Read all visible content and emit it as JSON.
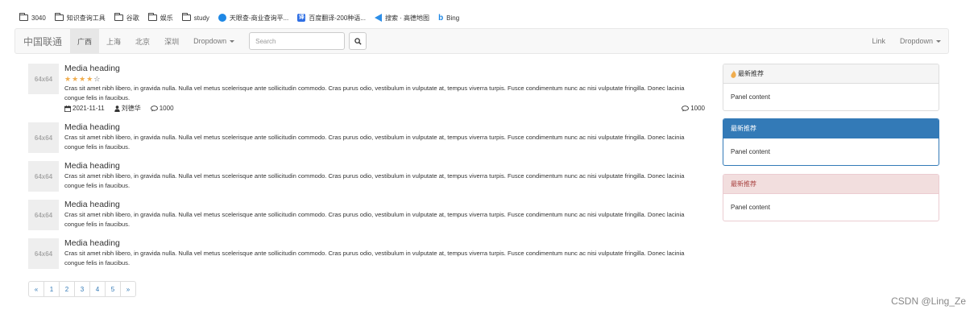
{
  "bookmarks": [
    {
      "label": "3040",
      "icon": "folder-icon"
    },
    {
      "label": "知识查询工具",
      "icon": "folder-icon"
    },
    {
      "label": "谷歌",
      "icon": "folder-icon"
    },
    {
      "label": "娱乐",
      "icon": "folder-icon"
    },
    {
      "label": "study",
      "icon": "folder-icon"
    },
    {
      "label": "天眼查-商业查询平...",
      "icon": "tianyancha-icon"
    },
    {
      "label": "百度翻译-200种语...",
      "icon": "baidu-translate-icon"
    },
    {
      "label": "搜索 · 高德地图",
      "icon": "amap-icon"
    },
    {
      "label": "Bing",
      "icon": "bing-icon"
    }
  ],
  "navbar": {
    "brand": "中国联通",
    "items": [
      "广西",
      "上海",
      "北京",
      "深圳"
    ],
    "active_index": 0,
    "dropdown": "Dropdown",
    "search_placeholder": "Search",
    "right_link": "Link",
    "right_dropdown": "Dropdown"
  },
  "media": {
    "thumb_label": "64x64",
    "items": [
      {
        "heading": "Media heading",
        "rating": 4,
        "rating_max": 5,
        "text": "Cras sit amet nibh libero, in gravida nulla. Nulla vel metus scelerisque ante sollicitudin commodo. Cras purus odio, vestibulum in vulputate at, tempus viverra turpis. Fusce condimentum nunc ac nisi vulputate fringilla. Donec lacinia congue felis in faucibus.",
        "date": "2021-11-11",
        "author": "刘德华",
        "comments": "1000",
        "comments_right": "1000"
      },
      {
        "heading": "Media heading",
        "text": "Cras sit amet nibh libero, in gravida nulla. Nulla vel metus scelerisque ante sollicitudin commodo. Cras purus odio, vestibulum in vulputate at, tempus viverra turpis. Fusce condimentum nunc ac nisi vulputate fringilla. Donec lacinia congue felis in faucibus."
      },
      {
        "heading": "Media heading",
        "text": "Cras sit amet nibh libero, in gravida nulla. Nulla vel metus scelerisque ante sollicitudin commodo. Cras purus odio, vestibulum in vulputate at, tempus viverra turpis. Fusce condimentum nunc ac nisi vulputate fringilla. Donec lacinia congue felis in faucibus."
      },
      {
        "heading": "Media heading",
        "text": "Cras sit amet nibh libero, in gravida nulla. Nulla vel metus scelerisque ante sollicitudin commodo. Cras purus odio, vestibulum in vulputate at, tempus viverra turpis. Fusce condimentum nunc ac nisi vulputate fringilla. Donec lacinia congue felis in faucibus."
      },
      {
        "heading": "Media heading",
        "text": "Cras sit amet nibh libero, in gravida nulla. Nulla vel metus scelerisque ante sollicitudin commodo. Cras purus odio, vestibulum in vulputate at, tempus viverra turpis. Fusce condimentum nunc ac nisi vulputate fringilla. Donec lacinia congue felis in faucibus."
      }
    ]
  },
  "panels": [
    {
      "title": "最新推荐",
      "body": "Panel content",
      "style": "default",
      "icon": "fire-icon"
    },
    {
      "title": "最新推荐",
      "body": "Panel content",
      "style": "primary"
    },
    {
      "title": "最新推荐",
      "body": "Panel content",
      "style": "danger"
    }
  ],
  "pagination": {
    "prev": "«",
    "pages": [
      "1",
      "2",
      "3",
      "4",
      "5"
    ],
    "next": "»"
  },
  "colors": {
    "primary": "#337ab7",
    "danger_bg": "#f2dede",
    "danger_text": "#a94442",
    "star": "#f0ad4e"
  },
  "watermark": "CSDN @Ling_Ze"
}
